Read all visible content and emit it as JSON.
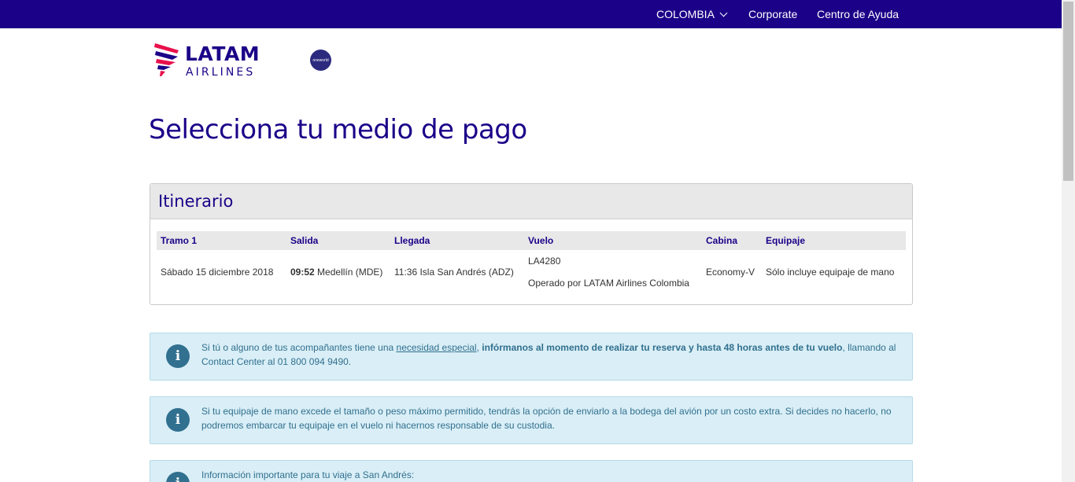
{
  "topbar": {
    "country": "COLOMBIA",
    "corporate": "Corporate",
    "help": "Centro de Ayuda"
  },
  "logo": {
    "line1": "LATAM",
    "line2": "AIRLINES",
    "partner": "oneworld"
  },
  "page": {
    "title": "Selecciona tu medio de pago"
  },
  "itinerary": {
    "heading": "Itinerario",
    "columns": [
      "Tramo 1",
      "Salida",
      "Llegada",
      "Vuelo",
      "Cabina",
      "Equipaje"
    ],
    "row": {
      "date": "Sábado 15 diciembre 2018",
      "departure_time": "09:52",
      "departure_place": "Medellín (MDE)",
      "arrival": "11:36 Isla San Andrés (ADZ)",
      "flight": "LA4280",
      "operator": "Operado por LATAM Airlines Colombia",
      "cabin": "Economy-V",
      "baggage": "Sólo incluye equipaje de mano"
    }
  },
  "alerts": [
    {
      "pre": "Si tú o alguno de tus acompañantes tiene una ",
      "link": "necesidad especial",
      "sep": ", ",
      "bold": "infórmanos al momento de realizar tu reserva y hasta 48 horas antes de tu vuelo",
      "post": ", llamando al Contact Center al 01 800 094 9490."
    },
    {
      "text": "Si tu equipaje de mano excede el tamaño o peso máximo permitido, tendrás la opción de enviarlo a la bodega del avión por un costo extra. Si decides no hacerlo, no podremos embarcar tu equipaje en el vuelo ni hacernos responsable de su custodia."
    },
    {
      "text": "Información importante para tu viaje a San Andrés:"
    }
  ],
  "icons": {
    "info": "i"
  },
  "colors": {
    "brand": "#1b0088",
    "info_bg": "#d9eef6",
    "info_text": "#31708f",
    "logo_accent": "#e8114b"
  }
}
